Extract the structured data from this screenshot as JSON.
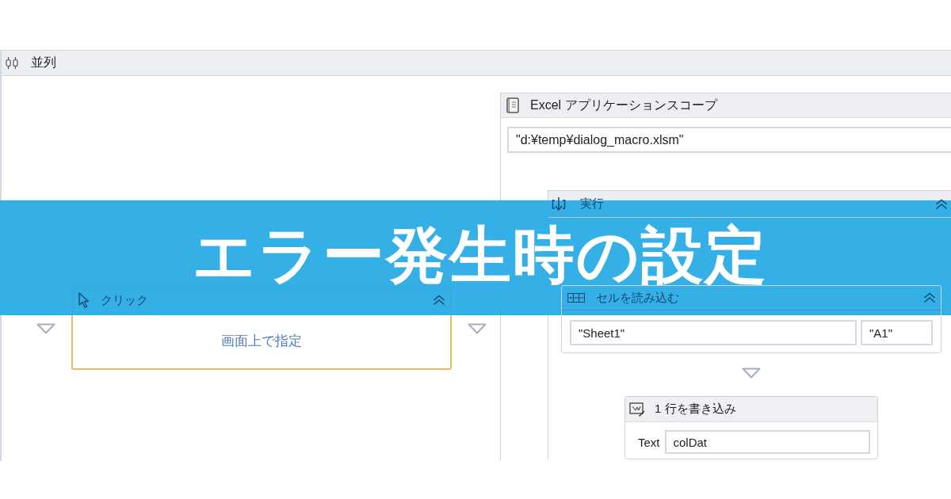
{
  "parallel": {
    "title": "並列"
  },
  "click": {
    "title": "クリック",
    "target": "画面上で指定",
    "selected": true
  },
  "excel_scope": {
    "title": "Excel アプリケーションスコープ",
    "path": "\"d:¥temp¥dialog_macro.xlsm\"",
    "selected": false
  },
  "sequence": {
    "title": "実行",
    "selected": false
  },
  "read_cell": {
    "title": "セルを読み込む",
    "sheet": "\"Sheet1\"",
    "cell": "\"A1\"",
    "selected": false
  },
  "write_line": {
    "title": "1 行を書き込み",
    "field_label": "Text",
    "value": "colDat",
    "selected": false
  },
  "banner": {
    "title": "エラー発生時の設定"
  }
}
